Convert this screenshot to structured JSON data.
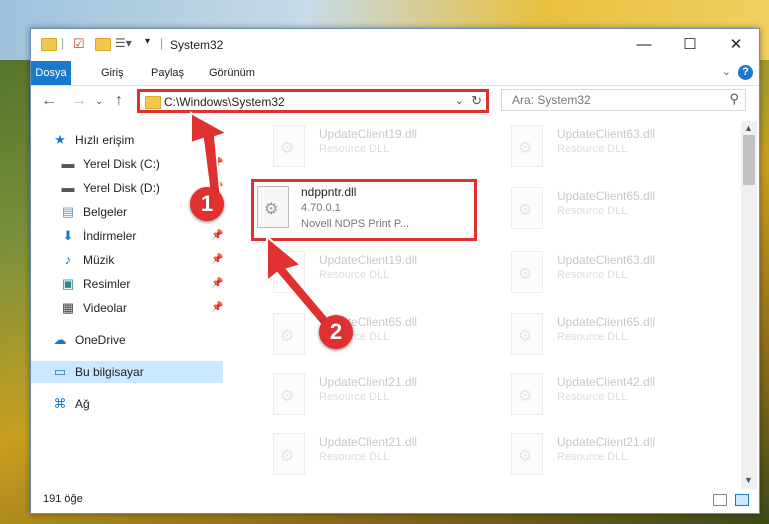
{
  "window": {
    "title": "System32"
  },
  "ribbon": {
    "tabs": [
      "Dosya",
      "Giriş",
      "Paylaş",
      "Görünüm"
    ]
  },
  "nav": {
    "address": "C:\\Windows\\System32",
    "search_placeholder": "Ara: System32"
  },
  "sidebar": {
    "items": [
      {
        "label": "Hızlı erişim",
        "icon": "star-icon"
      },
      {
        "label": "Yerel Disk (C:)",
        "icon": "drive-icon"
      },
      {
        "label": "Yerel Disk (D:)",
        "icon": "drive-icon"
      },
      {
        "label": "Belgeler",
        "icon": "document-icon"
      },
      {
        "label": "İndirmeler",
        "icon": "download-icon"
      },
      {
        "label": "Müzik",
        "icon": "music-icon"
      },
      {
        "label": "Resimler",
        "icon": "pictures-icon"
      },
      {
        "label": "Videolar",
        "icon": "video-icon"
      },
      {
        "label": "OneDrive",
        "icon": "cloud-icon"
      },
      {
        "label": "Bu bilgisayar",
        "icon": "computer-icon"
      },
      {
        "label": "Ağ",
        "icon": "network-icon"
      }
    ]
  },
  "files": {
    "highlighted": {
      "name": "ndppntr.dll",
      "version": "4.70.0.1",
      "description": "Novell NDPS Print P..."
    },
    "faded": [
      {
        "name": "UpdateClient19.dll",
        "desc": "Resource DLL"
      },
      {
        "name": "UpdateClient63.dll",
        "desc": "Resource DLL"
      },
      {
        "name": "UpdateClient65.dll",
        "desc": "Resource DLL"
      },
      {
        "name": "UpdateClient19.dll",
        "desc": "Resource DLL"
      },
      {
        "name": "UpdateClient63.dll",
        "desc": "Resource DLL"
      },
      {
        "name": "UpdateClient65.dll",
        "desc": "Resource DLL"
      },
      {
        "name": "UpdateClient65.dll",
        "desc": "Resource DLL"
      },
      {
        "name": "UpdateClient21.dll",
        "desc": "Resource DLL"
      },
      {
        "name": "UpdateClient42.dll",
        "desc": "Resource DLL"
      },
      {
        "name": "UpdateClient21.dll",
        "desc": "Resource DLL"
      },
      {
        "name": "UpdateClient21.dll",
        "desc": "Resource DLL"
      }
    ]
  },
  "status": {
    "count": "191 öğe"
  },
  "markers": {
    "one": "1",
    "two": "2"
  },
  "colors": {
    "accent": "#1979ca",
    "highlight": "#e03030"
  }
}
